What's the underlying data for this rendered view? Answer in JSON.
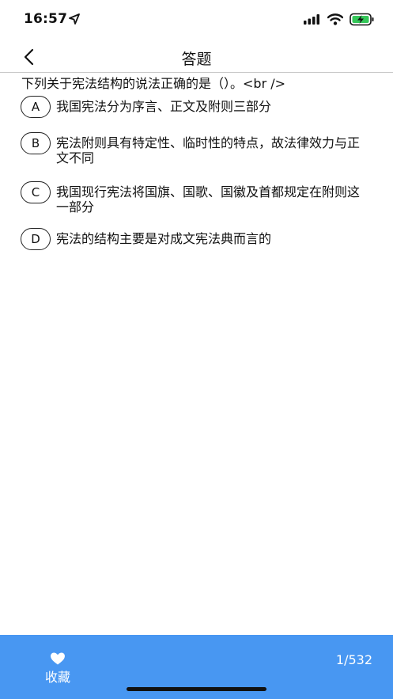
{
  "status_bar": {
    "time": "16:57",
    "icons": [
      "location-arrow-icon",
      "signal-icon",
      "wifi-icon",
      "battery-charging-icon"
    ]
  },
  "nav": {
    "title": "答题",
    "back_icon": "chevron-left-icon"
  },
  "question": {
    "text": "下列关于宪法结构的说法正确的是（）。<br />",
    "options": [
      {
        "letter": "A",
        "text": "我国宪法分为序言、正文及附则三部分"
      },
      {
        "letter": "B",
        "text": "宪法附则具有特定性、临时性的特点，故法律效力与正文不同"
      },
      {
        "letter": "C",
        "text": "我国现行宪法将国旗、国歌、国徽及首都规定在附则这一部分"
      },
      {
        "letter": "D",
        "text": "宪法的结构主要是对成文宪法典而言的"
      }
    ]
  },
  "bottom_bar": {
    "favorite_label": "收藏",
    "favorite_icon": "heart-icon",
    "page_counter": "1/532",
    "background_color": "#4897f2"
  }
}
